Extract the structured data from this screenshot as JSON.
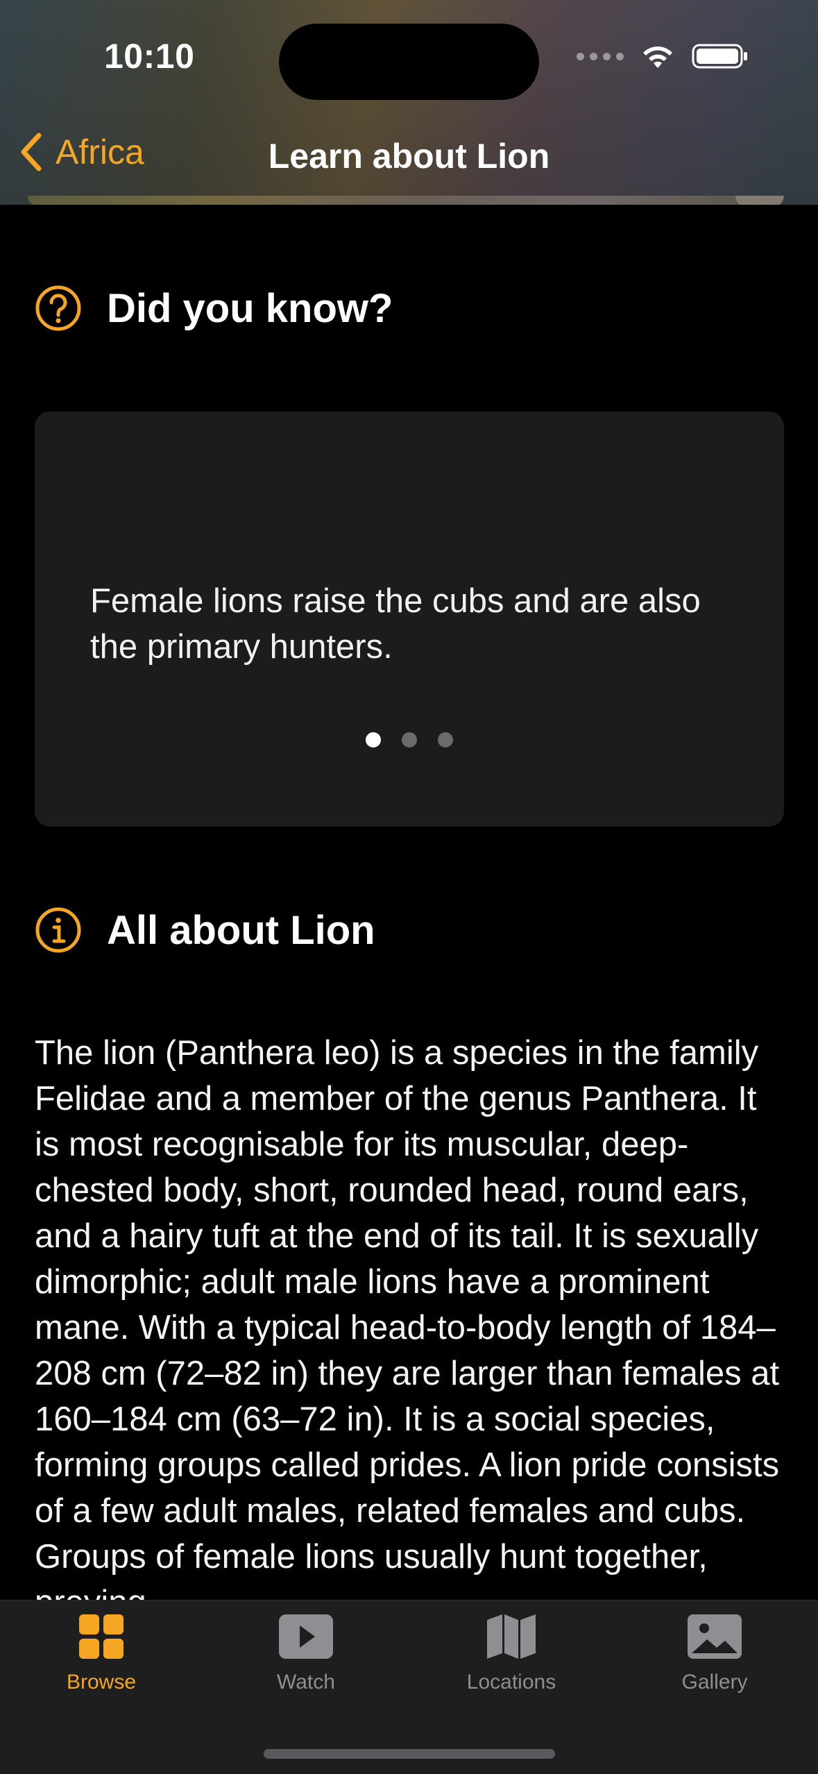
{
  "status": {
    "time": "10:10"
  },
  "nav": {
    "back_label": "Africa",
    "title": "Learn about Lion"
  },
  "did_you_know": {
    "heading": "Did you know?",
    "fact": "Female lions raise the cubs and are also the primary hunters.",
    "page_count": 3,
    "current_page": 1
  },
  "about": {
    "heading": "All about Lion",
    "body": "The lion (Panthera leo) is a species in the family Felidae and a member of the genus Panthera. It is most recognisable for its muscular, deep-chested body, short, rounded head, round ears, and a hairy tuft at the end of its tail. It is sexually dimorphic; adult male lions have a prominent mane. With a typical head-to-body length of 184–208 cm (72–82 in) they are larger than females at 160–184 cm (63–72 in). It is a social species, forming groups called prides. A lion pride consists of a few adult males, related females and cubs. Groups of female lions usually hunt together, preying"
  },
  "tabs": [
    {
      "label": "Browse",
      "icon": "grid-icon",
      "active": true
    },
    {
      "label": "Watch",
      "icon": "play-icon",
      "active": false
    },
    {
      "label": "Locations",
      "icon": "map-icon",
      "active": false
    },
    {
      "label": "Gallery",
      "icon": "photo-icon",
      "active": false
    }
  ],
  "colors": {
    "accent": "#f5a623",
    "card": "#1c1c1e",
    "tab_inactive": "#8e8e93"
  }
}
